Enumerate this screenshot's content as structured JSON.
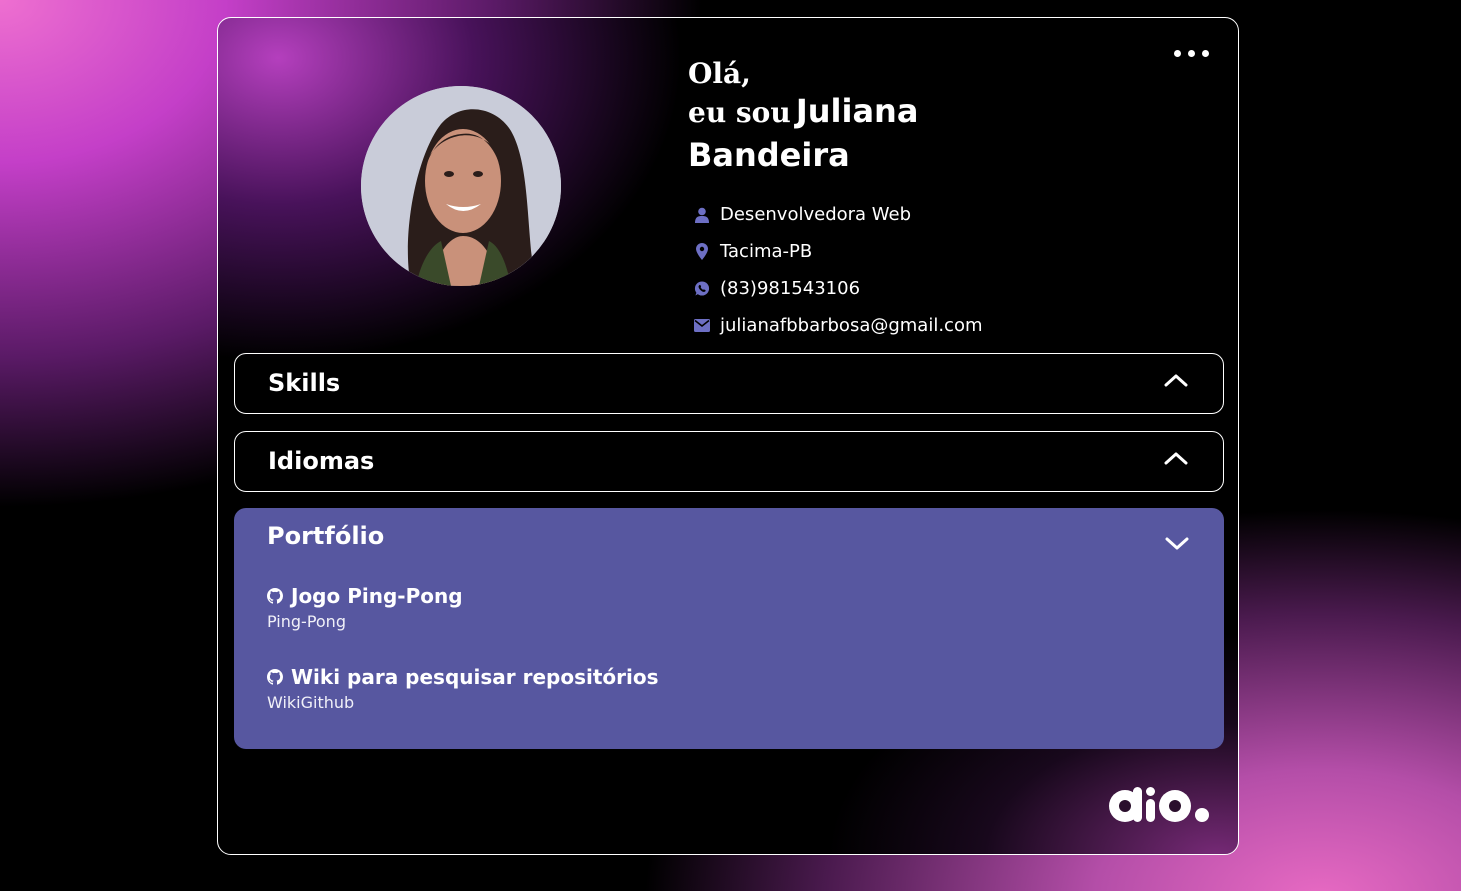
{
  "header": {
    "menu_icon": "more-dots-icon"
  },
  "profile": {
    "greeting_line1": "Olá,",
    "greeting_prefix": "eu sou",
    "first_name": "Juliana",
    "last_name": "Bandeira",
    "avatar_alt": "Foto de perfil"
  },
  "info": {
    "role": "Desenvolvedora Web",
    "location": "Tacima-PB",
    "phone": "(83)981543106",
    "email": "julianafbbarbosa@gmail.com"
  },
  "panels": {
    "skills": {
      "title": "Skills",
      "state": "collapsed"
    },
    "idiomas": {
      "title": "Idiomas",
      "state": "collapsed"
    },
    "portfolio": {
      "title": "Portfólio",
      "state": "expanded",
      "items": [
        {
          "title": "Jogo Ping-Pong",
          "subtitle": "Ping-Pong"
        },
        {
          "title": "Wiki para pesquisar repositórios",
          "subtitle": "WikiGithub"
        }
      ]
    }
  },
  "colors": {
    "accent_panel": "#5757a0",
    "icon_color": "#6d6fc4",
    "gradient_pink": "#e86ac3"
  },
  "logo": {
    "name": "dio-logo"
  }
}
